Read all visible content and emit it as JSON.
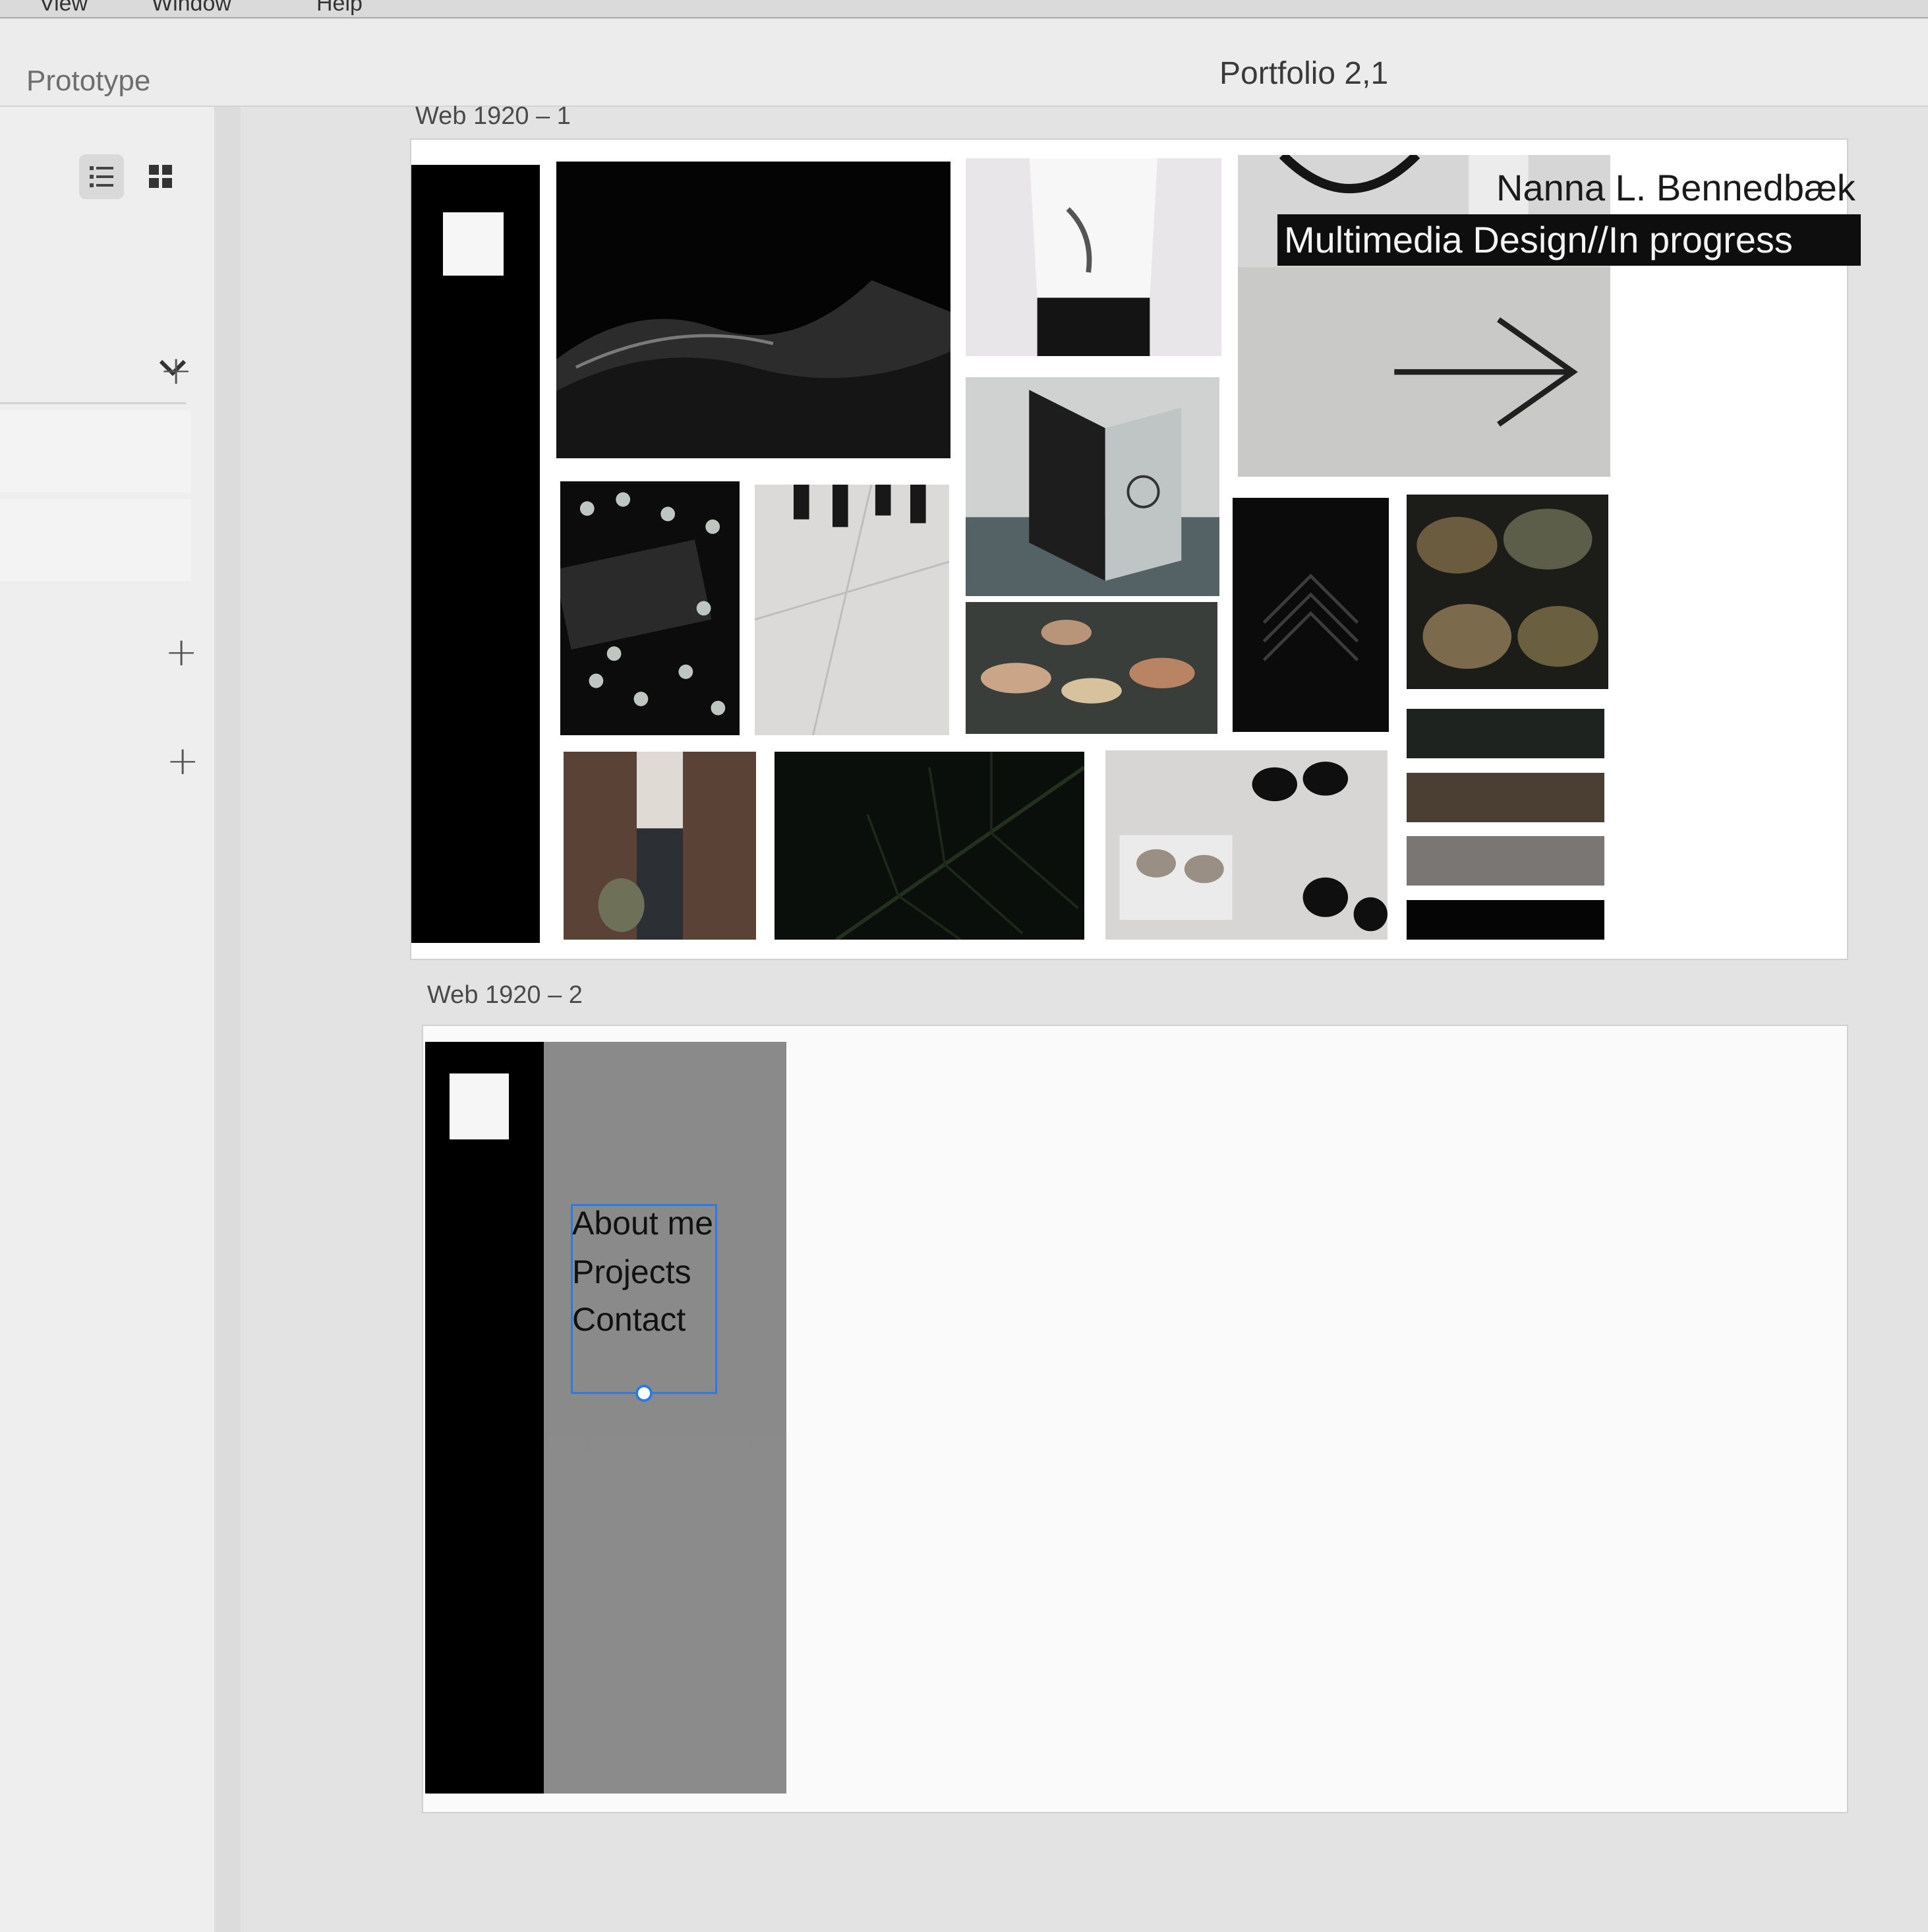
{
  "menubar": {
    "items": [
      "View",
      "Window",
      "Help"
    ]
  },
  "toolbar": {
    "mode_label": "Prototype",
    "document_title": "Portfolio 2,1"
  },
  "left_panel": {
    "view_modes": [
      "list-view-icon",
      "grid-view-icon"
    ],
    "add_buttons": [
      "+",
      "+",
      "+"
    ]
  },
  "artboards": [
    {
      "label": "Web 1920 – 1",
      "name_text": "Nanna L. Bennedbæk",
      "tagline": "Multimedia Design//In progress"
    },
    {
      "label": "Web 1920 – 2",
      "nav_items": [
        "About me",
        "Projects",
        "Contact"
      ]
    }
  ],
  "colors": {
    "selection": "#2d7be0",
    "sidebar": "#000000",
    "gray_panel": "#8a8a8a",
    "swatches": [
      "#1f2320",
      "#4b3f34",
      "#7a7674",
      "#050505"
    ]
  }
}
